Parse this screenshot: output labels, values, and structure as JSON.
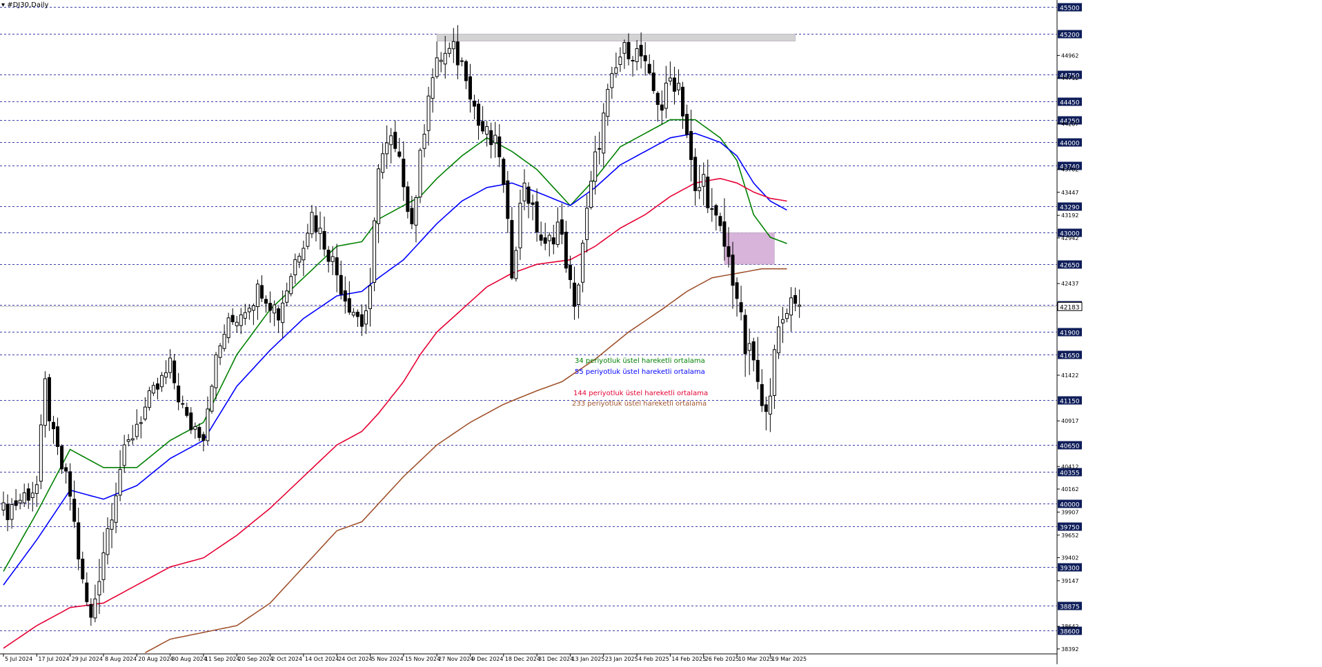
{
  "window": {
    "title": "▾ #DJ30,Daily"
  },
  "chart_data": {
    "type": "candlestick",
    "symbol": "#DJ30",
    "timeframe": "Daily",
    "ylim": [
      38392,
      45500
    ],
    "grid": "dashed horizontal lines at key levels",
    "key_levels": [
      45500,
      45200,
      44750,
      44450,
      44250,
      44000,
      43740,
      43290,
      43000,
      42650,
      42200,
      41900,
      41650,
      41150,
      40650,
      40355,
      40000,
      39750,
      39300,
      38875,
      38600
    ],
    "minor_ticks": [
      44962,
      44712,
      44207,
      43702,
      43447,
      43192,
      42942,
      42437,
      41422,
      40917,
      40412,
      40162,
      39907,
      39652,
      39402,
      39147,
      38642,
      38392
    ],
    "current_price": "42183",
    "current_price_value": 42183,
    "x_labels": [
      "5 Jul 2024",
      "17 Jul 2024",
      "29 Jul 2024",
      "8 Aug 2024",
      "20 Aug 2024",
      "30 Aug 2024",
      "11 Sep 2024",
      "20 Sep 2024",
      "2 Oct 2024",
      "14 Oct 2024",
      "24 Oct 2024",
      "5 Nov 2024",
      "15 Nov 2024",
      "27 Nov 2024",
      "9 Dec 2024",
      "18 Dec 2024",
      "31 Dec 2024",
      "13 Jan 2025",
      "23 Jan 2025",
      "4 Feb 2025",
      "14 Feb 2025",
      "26 Feb 2025",
      "10 Mar 2025",
      "19 Mar 2025"
    ],
    "x_label_index": [
      0,
      8,
      16,
      24,
      32,
      40,
      48,
      56,
      64,
      72,
      80,
      88,
      96,
      104,
      112,
      120,
      128,
      136,
      144,
      152,
      160,
      168,
      176,
      184
    ],
    "zones": [
      {
        "name": "resistance-zone",
        "x_from": 104,
        "x_to": 190,
        "y_from": 45200,
        "y_to": 45120,
        "color": "#d3d3d3"
      },
      {
        "name": "support-zone",
        "x_from": 173,
        "x_to": 185,
        "y_from": 43000,
        "y_to": 42650,
        "color": "#d8b4da"
      }
    ],
    "anchors": {
      "close": [
        [
          0,
          39900
        ],
        [
          8,
          40200
        ],
        [
          10,
          41300
        ],
        [
          12,
          40700
        ],
        [
          16,
          40100
        ],
        [
          19,
          39100
        ],
        [
          21,
          38700
        ],
        [
          24,
          39500
        ],
        [
          28,
          40400
        ],
        [
          32,
          40900
        ],
        [
          36,
          41200
        ],
        [
          40,
          41500
        ],
        [
          44,
          40900
        ],
        [
          48,
          40800
        ],
        [
          50,
          41400
        ],
        [
          53,
          41900
        ],
        [
          58,
          42200
        ],
        [
          62,
          42400
        ],
        [
          66,
          42100
        ],
        [
          70,
          42700
        ],
        [
          74,
          43200
        ],
        [
          78,
          42800
        ],
        [
          82,
          42300
        ],
        [
          86,
          42000
        ],
        [
          88,
          42300
        ],
        [
          90,
          43800
        ],
        [
          93,
          44000
        ],
        [
          96,
          43600
        ],
        [
          98,
          43100
        ],
        [
          100,
          43800
        ],
        [
          102,
          44600
        ],
        [
          105,
          44950
        ],
        [
          108,
          45000
        ],
        [
          111,
          44800
        ],
        [
          114,
          44200
        ],
        [
          117,
          44000
        ],
        [
          119,
          43900
        ],
        [
          122,
          42600
        ],
        [
          125,
          43600
        ],
        [
          127,
          43200
        ],
        [
          130,
          42800
        ],
        [
          133,
          43100
        ],
        [
          135,
          42700
        ],
        [
          137,
          42100
        ],
        [
          139,
          42900
        ],
        [
          142,
          43800
        ],
        [
          145,
          44500
        ],
        [
          148,
          44950
        ],
        [
          150,
          45050
        ],
        [
          153,
          44950
        ],
        [
          155,
          44650
        ],
        [
          158,
          44400
        ],
        [
          160,
          44700
        ],
        [
          162,
          44650
        ],
        [
          164,
          44100
        ],
        [
          166,
          43400
        ],
        [
          168,
          43600
        ],
        [
          170,
          43200
        ],
        [
          172,
          43000
        ],
        [
          174,
          42700
        ],
        [
          176,
          42300
        ],
        [
          178,
          41700
        ],
        [
          180,
          41600
        ],
        [
          182,
          41000
        ],
        [
          184,
          41300
        ],
        [
          186,
          41900
        ],
        [
          188,
          42200
        ],
        [
          190,
          42300
        ],
        [
          191,
          42183
        ]
      ],
      "range": [
        [
          0,
          150
        ],
        [
          16,
          250
        ],
        [
          21,
          350
        ],
        [
          40,
          200
        ],
        [
          60,
          220
        ],
        [
          90,
          280
        ],
        [
          120,
          220
        ],
        [
          140,
          260
        ],
        [
          150,
          220
        ],
        [
          176,
          400
        ],
        [
          191,
          250
        ]
      ]
    },
    "ema_series": [
      {
        "label": "34 periyotluk üstel hareketli ortalama",
        "color": "#008000",
        "period": 34,
        "anchors": [
          [
            0,
            39250
          ],
          [
            8,
            39900
          ],
          [
            16,
            40600
          ],
          [
            24,
            40400
          ],
          [
            32,
            40400
          ],
          [
            40,
            40700
          ],
          [
            48,
            40900
          ],
          [
            56,
            41650
          ],
          [
            64,
            42150
          ],
          [
            72,
            42500
          ],
          [
            80,
            42850
          ],
          [
            86,
            42900
          ],
          [
            90,
            43150
          ],
          [
            96,
            43300
          ],
          [
            100,
            43400
          ],
          [
            104,
            43600
          ],
          [
            110,
            43850
          ],
          [
            116,
            44050
          ],
          [
            122,
            43900
          ],
          [
            128,
            43700
          ],
          [
            136,
            43300
          ],
          [
            142,
            43600
          ],
          [
            148,
            43950
          ],
          [
            154,
            44100
          ],
          [
            160,
            44250
          ],
          [
            166,
            44250
          ],
          [
            172,
            44050
          ],
          [
            176,
            43800
          ],
          [
            180,
            43200
          ],
          [
            184,
            42950
          ],
          [
            188,
            42880
          ]
        ]
      },
      {
        "label": "55 periyotluk üstel hareketli ortalama",
        "color": "#0000ff",
        "period": 55,
        "anchors": [
          [
            0,
            39100
          ],
          [
            8,
            39600
          ],
          [
            16,
            40150
          ],
          [
            24,
            40050
          ],
          [
            32,
            40200
          ],
          [
            40,
            40500
          ],
          [
            48,
            40700
          ],
          [
            56,
            41300
          ],
          [
            64,
            41700
          ],
          [
            72,
            42050
          ],
          [
            80,
            42300
          ],
          [
            86,
            42350
          ],
          [
            90,
            42500
          ],
          [
            96,
            42700
          ],
          [
            100,
            42900
          ],
          [
            104,
            43100
          ],
          [
            110,
            43350
          ],
          [
            116,
            43500
          ],
          [
            122,
            43550
          ],
          [
            128,
            43450
          ],
          [
            136,
            43300
          ],
          [
            142,
            43500
          ],
          [
            148,
            43750
          ],
          [
            154,
            43900
          ],
          [
            160,
            44050
          ],
          [
            166,
            44100
          ],
          [
            172,
            44000
          ],
          [
            176,
            43850
          ],
          [
            180,
            43550
          ],
          [
            184,
            43350
          ],
          [
            188,
            43250
          ]
        ]
      },
      {
        "label": "144 periyotluk üstel hareketli ortalama",
        "color": "#e60033",
        "period": 144,
        "anchors": [
          [
            0,
            38400
          ],
          [
            8,
            38650
          ],
          [
            16,
            38850
          ],
          [
            24,
            38900
          ],
          [
            32,
            39100
          ],
          [
            40,
            39300
          ],
          [
            48,
            39400
          ],
          [
            56,
            39650
          ],
          [
            64,
            39950
          ],
          [
            72,
            40300
          ],
          [
            80,
            40650
          ],
          [
            86,
            40800
          ],
          [
            90,
            41000
          ],
          [
            96,
            41350
          ],
          [
            100,
            41650
          ],
          [
            104,
            41900
          ],
          [
            110,
            42150
          ],
          [
            116,
            42400
          ],
          [
            122,
            42550
          ],
          [
            128,
            42650
          ],
          [
            136,
            42700
          ],
          [
            142,
            42850
          ],
          [
            148,
            43050
          ],
          [
            154,
            43200
          ],
          [
            160,
            43400
          ],
          [
            166,
            43550
          ],
          [
            172,
            43600
          ],
          [
            176,
            43550
          ],
          [
            180,
            43450
          ],
          [
            184,
            43380
          ],
          [
            188,
            43350
          ]
        ]
      },
      {
        "label": "233 periyotluk üstel hareketli ortalama",
        "color": "#a0522d",
        "period": 233,
        "anchors": [
          [
            0,
            37500
          ],
          [
            20,
            38000
          ],
          [
            40,
            38500
          ],
          [
            56,
            38650
          ],
          [
            64,
            38900
          ],
          [
            72,
            39300
          ],
          [
            80,
            39700
          ],
          [
            86,
            39800
          ],
          [
            90,
            40000
          ],
          [
            96,
            40300
          ],
          [
            104,
            40650
          ],
          [
            112,
            40900
          ],
          [
            120,
            41100
          ],
          [
            128,
            41250
          ],
          [
            134,
            41350
          ],
          [
            142,
            41600
          ],
          [
            150,
            41900
          ],
          [
            158,
            42150
          ],
          [
            164,
            42350
          ],
          [
            170,
            42500
          ],
          [
            176,
            42550
          ],
          [
            182,
            42600
          ],
          [
            188,
            42600
          ]
        ]
      }
    ],
    "legend": [
      {
        "text": "34 periyotluk üstel hareketli ortalama",
        "color": "#008000"
      },
      {
        "text": "55 periyotluk üstel hareketli ortalama",
        "color": "#0000ff"
      },
      {
        "text": "144 periyotluk üstel hareketli ortalama",
        "color": "#e60033"
      },
      {
        "text": "233 periyotluk üstel hareketli ortalama",
        "color": "#a0522d"
      }
    ],
    "colors": {
      "grid": "#3a3aa8",
      "price_box": "#0f1e5a",
      "up_fill": "#ffffff",
      "down_fill": "#000000",
      "candle_stroke": "#000000"
    }
  }
}
